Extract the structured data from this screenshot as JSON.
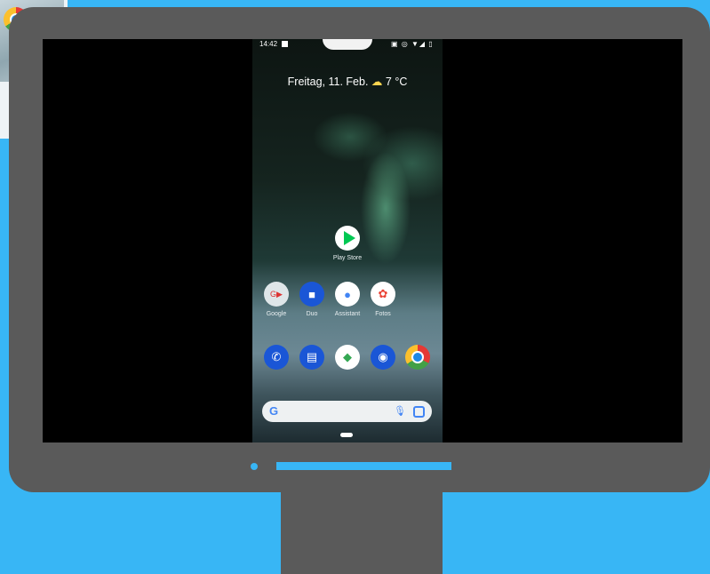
{
  "phone": {
    "status_time": "14:42",
    "status_icons": "▣ ◎ ▼◢ ▯",
    "date": "Freitag, 11. Feb.",
    "weather": "7 °C",
    "weather_icon": "cloud-sun-icon",
    "single_app": {
      "label": "Play Store",
      "icon": "play-store-icon"
    },
    "app_row": [
      {
        "label": "Google",
        "icon": "google-folder-icon"
      },
      {
        "label": "Duo",
        "icon": "duo-icon"
      },
      {
        "label": "Assistant",
        "icon": "assistant-icon"
      },
      {
        "label": "Fotos",
        "icon": "photos-icon"
      }
    ],
    "dock": [
      "phone-icon",
      "messages-icon",
      "files-icon",
      "camera-icon",
      "chrome-icon"
    ],
    "search_logo": "G"
  },
  "colors": {
    "background": "#38b6f5",
    "monitor": "#5a5a5a"
  }
}
